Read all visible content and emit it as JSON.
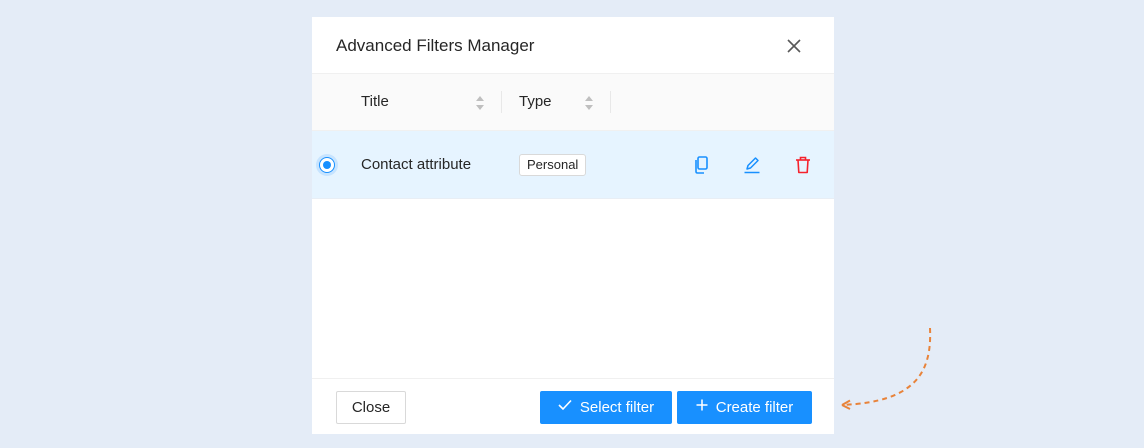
{
  "modal": {
    "title": "Advanced Filters Manager",
    "close_icon": "close-icon"
  },
  "table": {
    "columns": [
      {
        "label": "Title",
        "sortable": true
      },
      {
        "label": "Type",
        "sortable": true
      }
    ],
    "rows": [
      {
        "selected": true,
        "title": "Contact attribute",
        "type": "Personal",
        "actions": [
          "copy-icon",
          "edit-icon",
          "delete-icon"
        ]
      }
    ]
  },
  "footer": {
    "close_label": "Close",
    "select_label": "Select filter",
    "create_label": "Create filter"
  },
  "colors": {
    "primary": "#1890ff",
    "danger": "#f5222d",
    "row_selected_bg": "#e6f4ff",
    "page_bg": "#e4ecf7",
    "annotation_arrow": "#e8833a"
  }
}
